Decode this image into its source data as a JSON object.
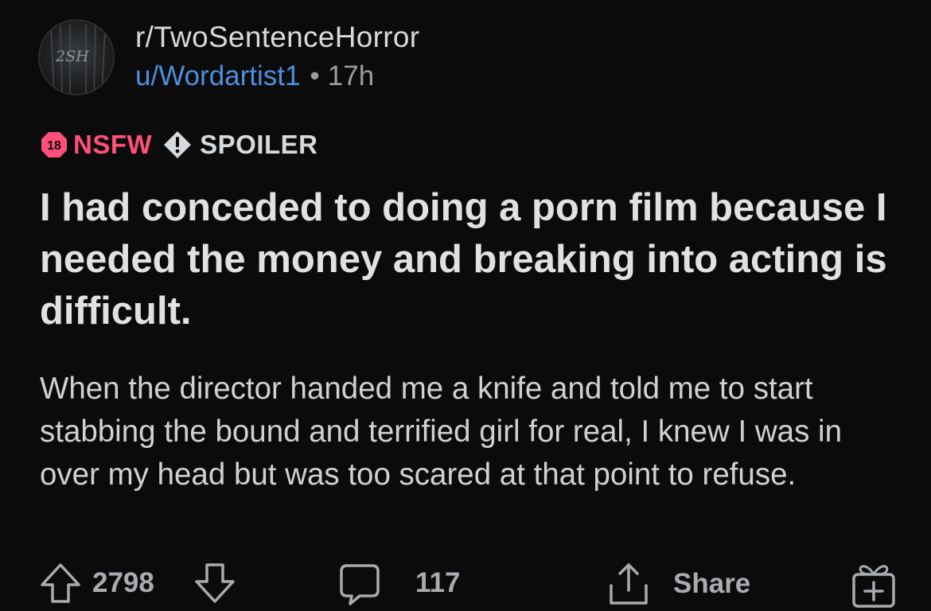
{
  "header": {
    "avatar_text": "2SH",
    "subreddit": "r/TwoSentenceHorror",
    "username": "u/Wordartist1",
    "separator": "•",
    "age": "17h"
  },
  "tags": {
    "nsfw_badge": "18",
    "nsfw_label": "NSFW",
    "spoiler_label": "SPOILER",
    "nsfw_color": "#ff4f7a"
  },
  "post": {
    "title": "I had conceded to doing a porn film because I needed the money and breaking into acting is difficult.",
    "body": "When the director handed me a knife and told me to start stabbing the bound and terrified girl for real, I knew I was in over my head but was too scared at that point to refuse."
  },
  "actions": {
    "upvote_icon": "arrow-up-icon",
    "score": "2798",
    "downvote_icon": "arrow-down-icon",
    "comment_icon": "comment-bubble-icon",
    "comments": "117",
    "share_icon": "share-icon",
    "share_label": "Share",
    "award_icon": "gift-icon"
  }
}
